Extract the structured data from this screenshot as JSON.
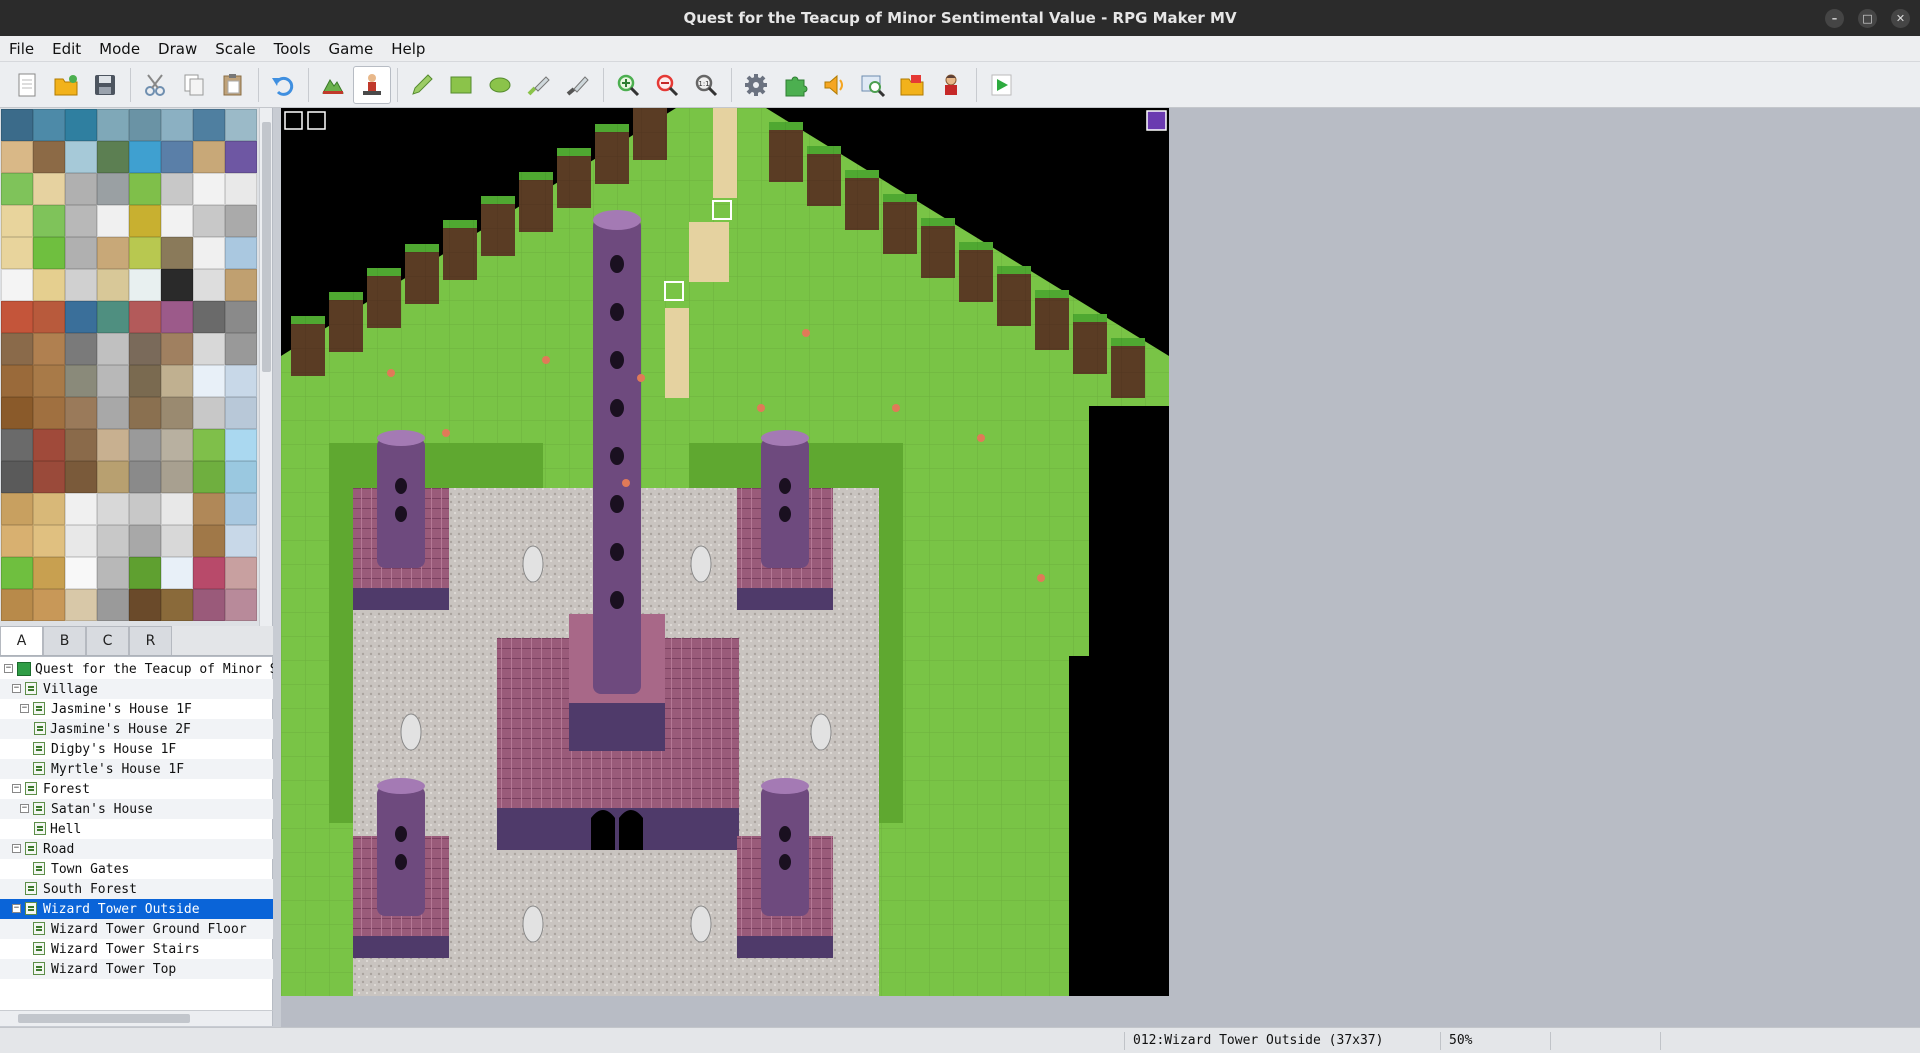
{
  "window": {
    "title": "Quest for the Teacup of Minor Sentimental Value - RPG Maker MV",
    "controls": [
      "minimize-icon",
      "maximize-icon",
      "close-icon"
    ]
  },
  "menu": [
    "File",
    "Edit",
    "Mode",
    "Draw",
    "Scale",
    "Tools",
    "Game",
    "Help"
  ],
  "toolbar": {
    "buttons": [
      {
        "name": "new-project-button",
        "icon": "new-file-icon"
      },
      {
        "name": "open-project-button",
        "icon": "open-folder-icon"
      },
      {
        "name": "save-project-button",
        "icon": "save-icon"
      },
      {
        "sep": true
      },
      {
        "name": "cut-button",
        "icon": "scissors-icon"
      },
      {
        "name": "copy-button",
        "icon": "copy-icon"
      },
      {
        "name": "paste-button",
        "icon": "paste-icon"
      },
      {
        "sep": true
      },
      {
        "name": "undo-button",
        "icon": "undo-icon"
      },
      {
        "sep": true
      },
      {
        "name": "map-mode-button",
        "icon": "map-mode-icon"
      },
      {
        "name": "event-mode-button",
        "icon": "event-mode-icon",
        "active": true
      },
      {
        "sep": true
      },
      {
        "name": "pencil-button",
        "icon": "pencil-icon"
      },
      {
        "name": "rectangle-button",
        "icon": "rectangle-icon"
      },
      {
        "name": "ellipse-button",
        "icon": "ellipse-icon"
      },
      {
        "name": "flood-fill-button",
        "icon": "fill-icon"
      },
      {
        "name": "shadow-pen-button",
        "icon": "shadow-pen-icon"
      },
      {
        "sep": true
      },
      {
        "name": "zoom-in-button",
        "icon": "zoom-in-icon"
      },
      {
        "name": "zoom-out-button",
        "icon": "zoom-out-icon"
      },
      {
        "name": "actual-size-button",
        "icon": "zoom-1to1-icon"
      },
      {
        "sep": true
      },
      {
        "name": "database-button",
        "icon": "gear-icon"
      },
      {
        "name": "plugin-manager-button",
        "icon": "puzzle-icon"
      },
      {
        "name": "sound-test-button",
        "icon": "speaker-icon"
      },
      {
        "name": "event-searcher-button",
        "icon": "search-window-icon"
      },
      {
        "name": "resource-manager-button",
        "icon": "folder-images-icon"
      },
      {
        "name": "character-generator-button",
        "icon": "character-icon"
      },
      {
        "sep": true
      },
      {
        "name": "playtest-button",
        "icon": "play-icon"
      }
    ]
  },
  "tileset_tabs": [
    {
      "label": "A",
      "selected": true
    },
    {
      "label": "B",
      "selected": false
    },
    {
      "label": "C",
      "selected": false
    },
    {
      "label": "R",
      "selected": false
    }
  ],
  "map_tree": [
    {
      "label": "Quest for the Teacup of Minor Sentimental Value",
      "depth": 0,
      "root": true,
      "expand": "minus"
    },
    {
      "label": "Village",
      "depth": 1,
      "expand": "minus"
    },
    {
      "label": "Jasmine's House 1F",
      "depth": 2,
      "expand": "minus"
    },
    {
      "label": "Jasmine's House 2F",
      "depth": 3
    },
    {
      "label": "Digby's House 1F",
      "depth": 2
    },
    {
      "label": "Myrtle's House 1F",
      "depth": 2
    },
    {
      "label": "Forest",
      "depth": 1,
      "expand": "minus"
    },
    {
      "label": "Satan's House",
      "depth": 2,
      "expand": "minus"
    },
    {
      "label": "Hell",
      "depth": 3
    },
    {
      "label": "Road",
      "depth": 1,
      "expand": "minus"
    },
    {
      "label": "Town Gates",
      "depth": 2
    },
    {
      "label": "South Forest",
      "depth": 1
    },
    {
      "label": "Wizard Tower Outside",
      "depth": 1,
      "expand": "minus",
      "selected": true
    },
    {
      "label": "Wizard Tower Ground Floor",
      "depth": 2
    },
    {
      "label": "Wizard Tower Stairs",
      "depth": 2
    },
    {
      "label": "Wizard Tower Top",
      "depth": 2
    }
  ],
  "status": {
    "map_info": "012:Wizard Tower Outside (37x37)",
    "zoom": "50%"
  },
  "colors": {
    "selection": "#0a64d8",
    "grass": "#79c446",
    "pavement": "#c9c4c0",
    "tower": "#6e4a7e",
    "plinth": "#9a5b7a"
  }
}
